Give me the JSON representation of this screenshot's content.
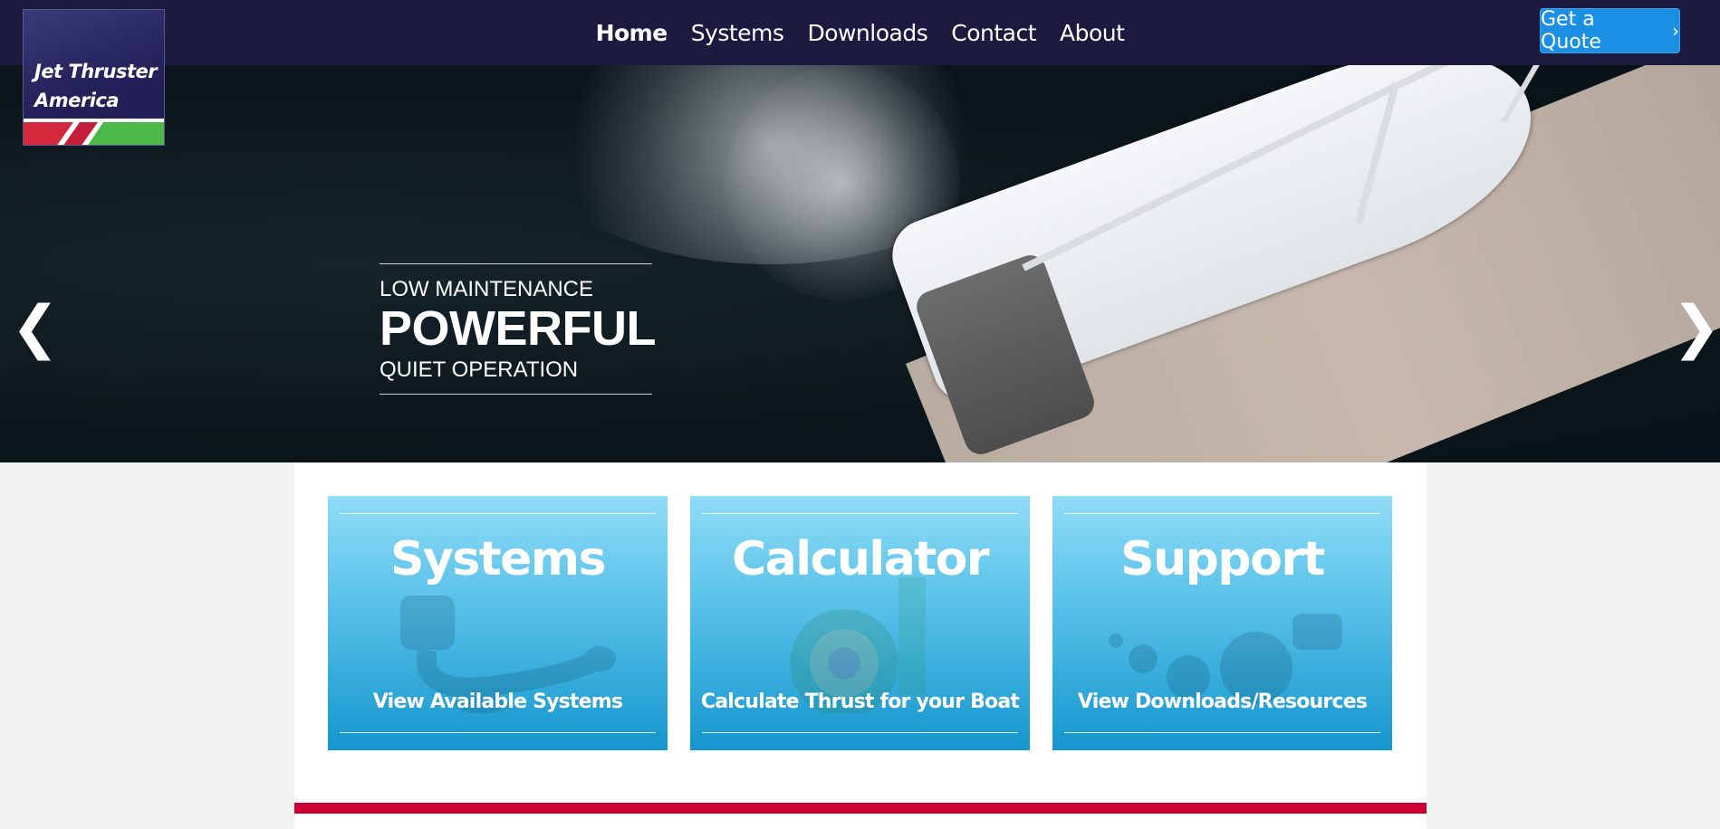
{
  "logo": {
    "line1": "Jet Thruster",
    "line2": "America"
  },
  "nav": [
    {
      "label": "Home",
      "active": true
    },
    {
      "label": "Systems"
    },
    {
      "label": "Downloads"
    },
    {
      "label": "Contact"
    },
    {
      "label": "About"
    }
  ],
  "quote_button": {
    "label": "Get a Quote",
    "icon": "chevron-right-icon",
    "glyph": "›"
  },
  "hero": {
    "line1": "LOW MAINTENANCE",
    "line2": "POWERFUL",
    "line3": "QUIET OPERATION",
    "prev_glyph": "❮",
    "next_glyph": "❯"
  },
  "cards": [
    {
      "title": "Systems",
      "subtitle": "View Available Systems"
    },
    {
      "title": "Calculator",
      "subtitle": "Calculate Thrust for your Boat"
    },
    {
      "title": "Support",
      "subtitle": "View Downloads/Resources"
    }
  ],
  "colors": {
    "navbar": "#1d1a40",
    "quote_button": "#1a8fe3",
    "card_top": "#8fdcf6",
    "card_bottom": "#1596cd",
    "accent_bar": "#cc0033"
  }
}
